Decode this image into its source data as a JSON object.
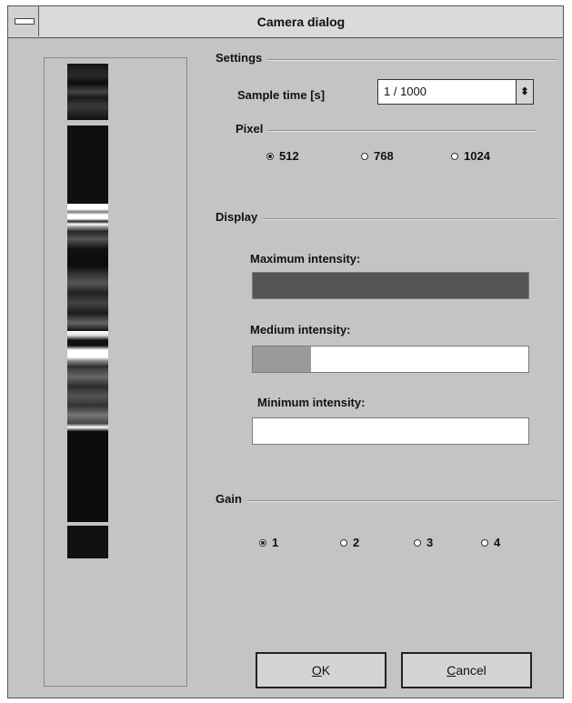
{
  "window": {
    "title": "Camera dialog"
  },
  "settings": {
    "group_label": "Settings",
    "sample_time_label": "Sample time [s]",
    "sample_time_value": "1 / 1000",
    "pixel_label": "Pixel",
    "pixel_options": [
      {
        "label": "512",
        "selected": true
      },
      {
        "label": "768",
        "selected": false
      },
      {
        "label": "1024",
        "selected": false
      }
    ]
  },
  "display": {
    "group_label": "Display",
    "maximum_label": "Maximum intensity:",
    "maximum_level": 1.0,
    "maximum_color": "#555555",
    "medium_label": "Medium intensity:",
    "medium_level": 0.21,
    "medium_color": "#9a9a9a",
    "minimum_label": "Minimum intensity:",
    "minimum_level": 0.0
  },
  "gain": {
    "group_label": "Gain",
    "options": [
      {
        "label": "1",
        "selected": true
      },
      {
        "label": "2",
        "selected": false
      },
      {
        "label": "3",
        "selected": false
      },
      {
        "label": "4",
        "selected": false
      }
    ]
  },
  "buttons": {
    "ok_underlined": "O",
    "ok_rest": "K",
    "cancel_underlined": "C",
    "cancel_rest": "ancel"
  }
}
